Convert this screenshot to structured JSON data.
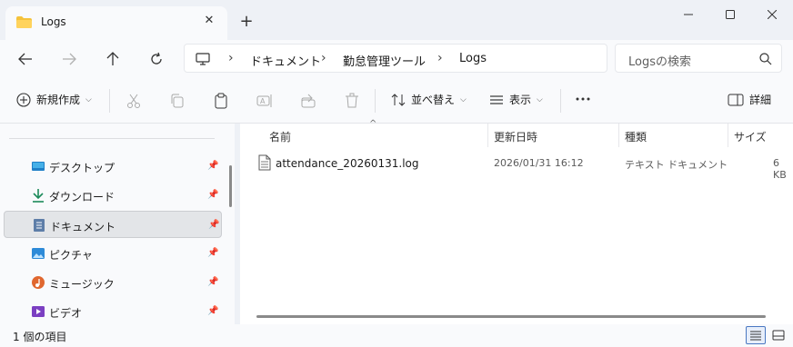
{
  "window": {
    "tab_title": "Logs"
  },
  "address": {
    "crumbs": [
      "ドキュメント",
      "勤怠管理ツール",
      "Logs"
    ]
  },
  "search": {
    "placeholder": "Logsの検索"
  },
  "commands": {
    "new_label": "新規作成",
    "sort_label": "並べ替え",
    "view_label": "表示",
    "details_label": "詳細"
  },
  "sidebar": {
    "items": [
      {
        "label": "デスクトップ",
        "icon": "desktop-icon"
      },
      {
        "label": "ダウンロード",
        "icon": "download-icon"
      },
      {
        "label": "ドキュメント",
        "icon": "documents-icon",
        "active": true
      },
      {
        "label": "ピクチャ",
        "icon": "pictures-icon"
      },
      {
        "label": "ミュージック",
        "icon": "music-icon"
      },
      {
        "label": "ビデオ",
        "icon": "videos-icon"
      }
    ]
  },
  "table": {
    "headers": [
      "名前",
      "更新日時",
      "種類",
      "サイズ"
    ],
    "rows": [
      {
        "name": "attendance_20260131.log",
        "modified": "2026/01/31 16:12",
        "type": "テキスト ドキュメント",
        "size": "6 KB"
      }
    ]
  },
  "status": {
    "item_count": "1 個の項目"
  },
  "colors": {
    "accent": "#4a78c2",
    "folder": "#f5c23b"
  }
}
